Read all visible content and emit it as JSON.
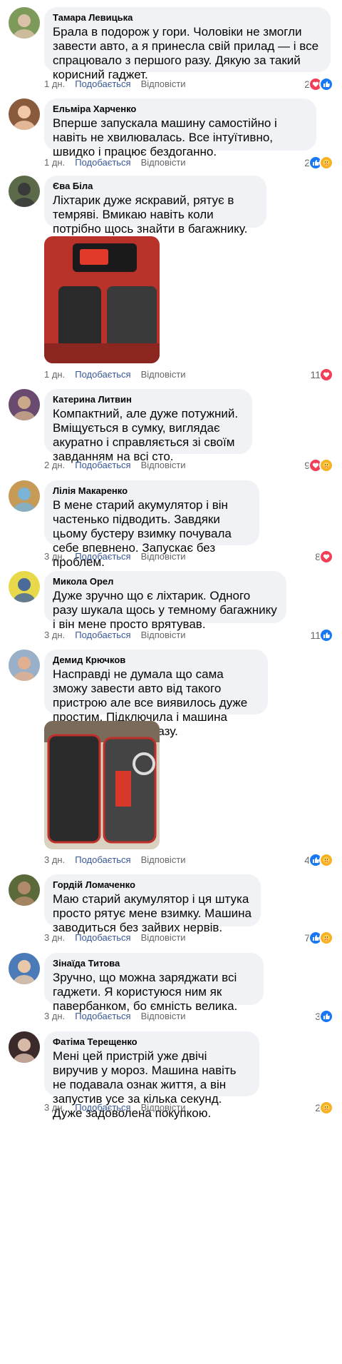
{
  "labels": {
    "like": "Подобається",
    "reply": "Відповісти"
  },
  "comments": [
    {
      "author": "Тамара Левицька",
      "text": "Брала в подорож у гори. Чоловіки не змогли завести авто, а я принесла свій прилад — і все спрацювало з першого разу. Дякую за такий корисний гаджет.",
      "time": "1 дн.",
      "reactions_count": "2",
      "reactions": [
        "love",
        "like"
      ],
      "avatar": {
        "c1": "#7d9a5a",
        "c2": "#d9c2a8"
      }
    },
    {
      "author": "Ельміра Харченко",
      "text": "Вперше запускала машину самостійно і навіть не хвилювалась. Все інтуїтивно, швидко і працює бездоганно.",
      "time": "1 дн.",
      "reactions_count": "2",
      "reactions": [
        "like",
        "care"
      ],
      "avatar": {
        "c1": "#8a5a3c",
        "c2": "#f1c9a8"
      }
    },
    {
      "author": "Єва Біла",
      "text": "Ліхтарик дуже яскравий, рятує в темряві. Вмикаю навіть коли потрібно щось знайти в багажнику.",
      "time": "1 дн.",
      "reactions_count": "11",
      "reactions": [
        "love"
      ],
      "avatar": {
        "c1": "#5b6b4a",
        "c2": "#3a3a3a"
      }
    },
    {
      "author": "Катерина Литвин",
      "text": "Компактний, але дуже потужний. Вміщується в сумку, виглядає акуратно і справляється зі своїм завданням на всі сто.",
      "time": "2 дн.",
      "reactions_count": "9",
      "reactions": [
        "love",
        "care"
      ],
      "avatar": {
        "c1": "#6a4a6e",
        "c2": "#c9a98a"
      }
    },
    {
      "author": "Лілія Макаренко",
      "text": "В мене старий акумулятор і він частенько підводить. Завдяки цьому бустеру взимку почувала себе впевнено. Запускає без проблем.",
      "time": "3 дн.",
      "reactions_count": "8",
      "reactions": [
        "love"
      ],
      "avatar": {
        "c1": "#c79a55",
        "c2": "#7ab3d6"
      }
    },
    {
      "author": "Микола Орел",
      "text": "Дуже зручно що є ліхтарик. Одного разу шукала щось у темному багажнику і він мене просто врятував.",
      "time": "3 дн.",
      "reactions_count": "11",
      "reactions": [
        "like"
      ],
      "avatar": {
        "c1": "#e8d94a",
        "c2": "#4a6a9a"
      }
    },
    {
      "author": "Демид Крючков",
      "text": "Насправді не думала що сама зможу завести авто від такого пристрою але все виявилось дуже простим. Підключила і машина ожила з першого разу.",
      "time": "3 дн.",
      "reactions_count": "4",
      "reactions": [
        "like",
        "care"
      ],
      "avatar": {
        "c1": "#9ab0c8",
        "c2": "#e0b090"
      }
    },
    {
      "author": "Гордій Ломаченко",
      "text": "Маю старий акумулятор і ця штука просто рятує мене взимку. Машина заводиться без зайвих нервів.",
      "time": "3 дн.",
      "reactions_count": "7",
      "reactions": [
        "like",
        "care"
      ],
      "avatar": {
        "c1": "#5a6a3a",
        "c2": "#b08a6a"
      }
    },
    {
      "author": "Зінаїда Титова",
      "text": "Зручно, що можна заряджати всі гаджети. Я користуюся ним як павербанком, бо ємність велика.",
      "time": "3 дн.",
      "reactions_count": "3",
      "reactions": [
        "like"
      ],
      "avatar": {
        "c1": "#4a7ab8",
        "c2": "#e8c8a8"
      }
    },
    {
      "author": "Фатіма Терещенко",
      "text": "Мені цей пристрій уже двічі виручив у мороз. Машина навіть не подавала ознак життя, а він запустив усе за кілька секунд. Дуже задоволена покупкою.",
      "time": "3 дн.",
      "reactions_count": "2",
      "reactions": [
        "care"
      ],
      "avatar": {
        "c1": "#3a2a2a",
        "c2": "#d8b8a8"
      }
    }
  ]
}
